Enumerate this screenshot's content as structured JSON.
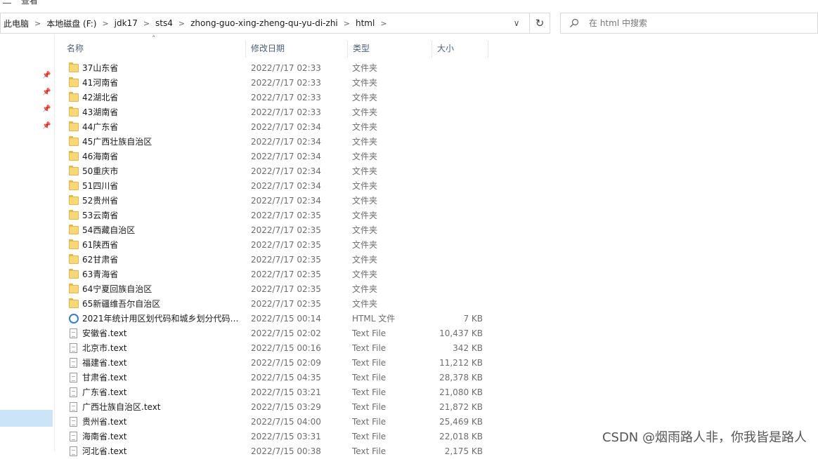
{
  "toolbar": {
    "view_menu": "查看"
  },
  "breadcrumb": [
    "此电脑",
    "本地磁盘 (F:)",
    "jdk17",
    "sts4",
    "zhong-guo-xing-zheng-qu-yu-di-zhi",
    "html"
  ],
  "search": {
    "placeholder": "在 html 中搜索"
  },
  "columns": {
    "name": "名称",
    "date": "修改日期",
    "type": "类型",
    "size": "大小"
  },
  "files": [
    {
      "name": "37山东省",
      "date": "2022/7/17 02:33",
      "type": "文件夹",
      "size": "",
      "icon": "folder-icon"
    },
    {
      "name": "41河南省",
      "date": "2022/7/17 02:33",
      "type": "文件夹",
      "size": "",
      "icon": "folder-icon"
    },
    {
      "name": "42湖北省",
      "date": "2022/7/17 02:33",
      "type": "文件夹",
      "size": "",
      "icon": "folder-icon"
    },
    {
      "name": "43湖南省",
      "date": "2022/7/17 02:33",
      "type": "文件夹",
      "size": "",
      "icon": "folder-icon"
    },
    {
      "name": "44广东省",
      "date": "2022/7/17 02:34",
      "type": "文件夹",
      "size": "",
      "icon": "folder-icon"
    },
    {
      "name": "45广西壮族自治区",
      "date": "2022/7/17 02:34",
      "type": "文件夹",
      "size": "",
      "icon": "folder-icon"
    },
    {
      "name": "46海南省",
      "date": "2022/7/17 02:34",
      "type": "文件夹",
      "size": "",
      "icon": "folder-icon"
    },
    {
      "name": "50重庆市",
      "date": "2022/7/17 02:34",
      "type": "文件夹",
      "size": "",
      "icon": "folder-icon"
    },
    {
      "name": "51四川省",
      "date": "2022/7/17 02:34",
      "type": "文件夹",
      "size": "",
      "icon": "folder-icon"
    },
    {
      "name": "52贵州省",
      "date": "2022/7/17 02:34",
      "type": "文件夹",
      "size": "",
      "icon": "folder-icon"
    },
    {
      "name": "53云南省",
      "date": "2022/7/17 02:35",
      "type": "文件夹",
      "size": "",
      "icon": "folder-icon"
    },
    {
      "name": "54西藏自治区",
      "date": "2022/7/17 02:35",
      "type": "文件夹",
      "size": "",
      "icon": "folder-icon"
    },
    {
      "name": "61陕西省",
      "date": "2022/7/17 02:35",
      "type": "文件夹",
      "size": "",
      "icon": "folder-icon"
    },
    {
      "name": "62甘肃省",
      "date": "2022/7/17 02:35",
      "type": "文件夹",
      "size": "",
      "icon": "folder-icon"
    },
    {
      "name": "63青海省",
      "date": "2022/7/17 02:35",
      "type": "文件夹",
      "size": "",
      "icon": "folder-icon"
    },
    {
      "name": "64宁夏回族自治区",
      "date": "2022/7/17 02:35",
      "type": "文件夹",
      "size": "",
      "icon": "folder-icon"
    },
    {
      "name": "65新疆维吾尔自治区",
      "date": "2022/7/17 02:35",
      "type": "文件夹",
      "size": "",
      "icon": "folder-icon"
    },
    {
      "name": "2021年统计用区划代码和城乡划分代码....",
      "date": "2022/7/15 00:14",
      "type": "HTML 文件",
      "size": "7 KB",
      "icon": "html-file-icon"
    },
    {
      "name": "安徽省.text",
      "date": "2022/7/15 02:02",
      "type": "Text File",
      "size": "10,437 KB",
      "icon": "text-file-icon"
    },
    {
      "name": "北京市.text",
      "date": "2022/7/15 00:16",
      "type": "Text File",
      "size": "342 KB",
      "icon": "text-file-icon"
    },
    {
      "name": "福建省.text",
      "date": "2022/7/15 02:09",
      "type": "Text File",
      "size": "11,212 KB",
      "icon": "text-file-icon"
    },
    {
      "name": "甘肃省.text",
      "date": "2022/7/15 04:35",
      "type": "Text File",
      "size": "28,378 KB",
      "icon": "text-file-icon"
    },
    {
      "name": "广东省.text",
      "date": "2022/7/15 03:21",
      "type": "Text File",
      "size": "21,080 KB",
      "icon": "text-file-icon"
    },
    {
      "name": "广西壮族自治区.text",
      "date": "2022/7/15 03:29",
      "type": "Text File",
      "size": "21,872 KB",
      "icon": "text-file-icon"
    },
    {
      "name": "贵州省.text",
      "date": "2022/7/15 04:00",
      "type": "Text File",
      "size": "25,469 KB",
      "icon": "text-file-icon"
    },
    {
      "name": "海南省.text",
      "date": "2022/7/15 03:31",
      "type": "Text File",
      "size": "22,018 KB",
      "icon": "text-file-icon"
    },
    {
      "name": "河北省.text",
      "date": "2022/7/15 00:38",
      "type": "Text File",
      "size": "2,175 KB",
      "icon": "text-file-icon"
    }
  ],
  "watermark": "CSDN @烟雨路人非，你我皆是路人"
}
